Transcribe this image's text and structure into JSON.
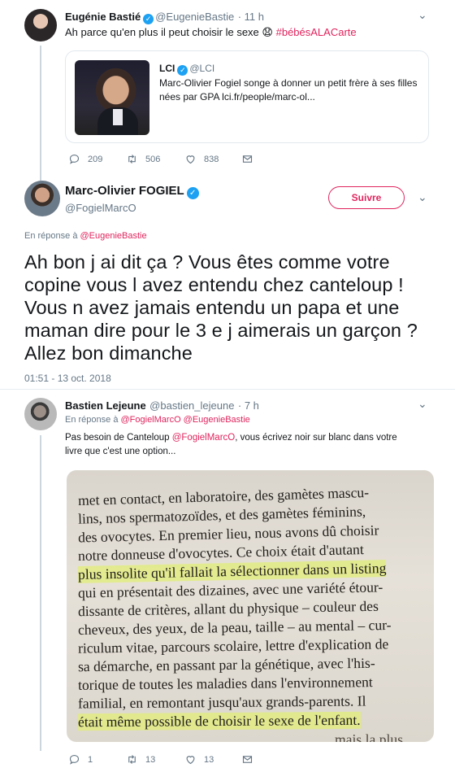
{
  "tweet1": {
    "name": "Eugénie Bastié",
    "handle": "@EugenieBastie",
    "time": "· 11 h",
    "text": "Ah parce qu'en plus il peut choisir le sexe",
    "emoji": "😧",
    "hashtag": "#bébésALACarte",
    "quote": {
      "name": "LCI",
      "handle": "@LCI",
      "text": "Marc-Olivier Fogiel songe à donner un petit frère à ses filles nées par GPA lci.fr/people/marc-ol..."
    },
    "replies": "209",
    "retweets": "506",
    "likes": "838"
  },
  "tweet2": {
    "name": "Marc-Olivier FOGIEL",
    "handle": "@FogielMarcO",
    "follow_label": "Suivre",
    "reply_prefix": "En réponse à",
    "reply_to": "@EugenieBastie",
    "text": "Ah bon j ai dit ça ? Vous êtes comme votre copine vous l avez entendu chez canteloup ! Vous n avez jamais entendu un papa et une maman dire pour le 3 e j aimerais un garçon ? Allez bon dimanche",
    "timestamp": "01:51 - 13 oct. 2018"
  },
  "tweet3": {
    "name": "Bastien Lejeune",
    "handle": "@bastien_lejeune",
    "time": "· 7 h",
    "reply_prefix": "En réponse à",
    "reply_to": "@FogielMarcO @EugenieBastie",
    "text_a": "Pas besoin de Canteloup",
    "text_mention": "@FogielMarcO",
    "text_b": ", vous écrivez noir sur blanc dans votre",
    "text_c": "livre que c'est une option...",
    "book_lines": [
      "met en contact, en laboratoire, des gamètes mascu-",
      "lins, nos spermatozoïdes, et des gamètes féminins,",
      "des ovocytes. En premier lieu, nous avons dû choisir",
      "notre donneuse d'ovocytes. Ce choix était d'autant",
      "plus insolite qu'il fallait la sélectionner dans un listing",
      "qui en présentait des dizaines, avec une variété étour-",
      "dissante de critères, allant du physique – couleur des",
      "cheveux, des yeux, de la peau, taille – au mental – cur-",
      "riculum vitae, parcours scolaire, lettre d'explication de",
      "sa démarche, en passant par la génétique, avec l'his-",
      "torique de toutes les maladies dans l'environnement",
      "familial, en remontant jusqu'aux grands-parents. Il",
      "était même possible de choisir le sexe de l'enfant.",
      "mais la plus"
    ],
    "replies": "1",
    "retweets": "13",
    "likes": "13"
  },
  "colors": {
    "accent": "#1da1f2",
    "mention": "#e0245e",
    "muted": "#657786"
  }
}
